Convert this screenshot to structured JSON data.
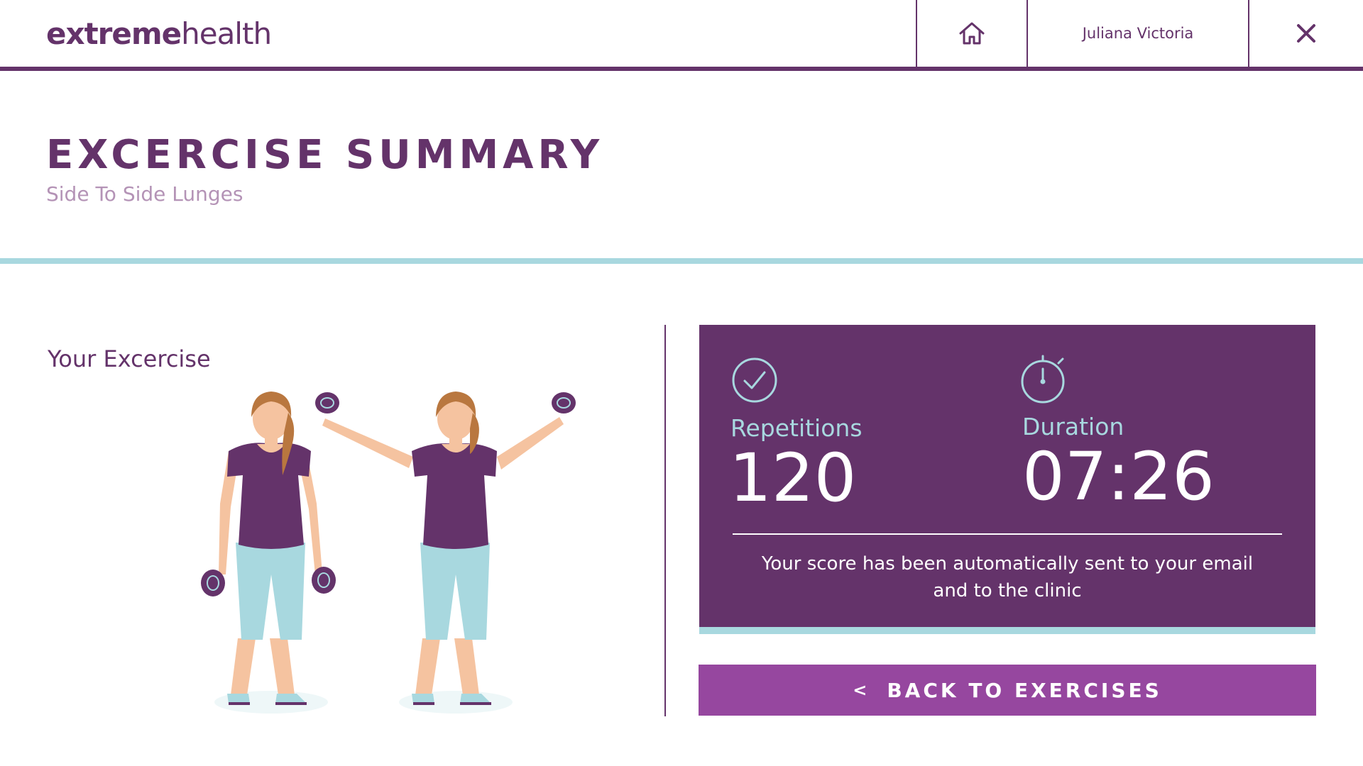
{
  "header": {
    "logo_bold": "extreme",
    "logo_light": "health",
    "home_icon": "home-icon",
    "user_name": "Juliana Victoria",
    "close_icon": "close-icon"
  },
  "page": {
    "title": "EXCERCISE SUMMARY",
    "subtitle": "Side To Side Lunges"
  },
  "exercise": {
    "heading": "Your Excercise",
    "illustration": "dumbbell-lateral-raise-illustration"
  },
  "stats": {
    "repetitions": {
      "label": "Repetitions",
      "value": "120",
      "icon": "check-circle-icon"
    },
    "duration": {
      "label": "Duration",
      "value": "07:26",
      "icon": "stopwatch-icon"
    },
    "message": "Your score has been automatically sent to your email and to the clinic"
  },
  "actions": {
    "back_chevron": "<",
    "back_label": "BACK TO EXERCISES"
  },
  "colors": {
    "brand_purple": "#64336a",
    "accent_teal": "#a8d8df",
    "button_purple": "#96479f",
    "subtitle_lilac": "#b493b6"
  }
}
